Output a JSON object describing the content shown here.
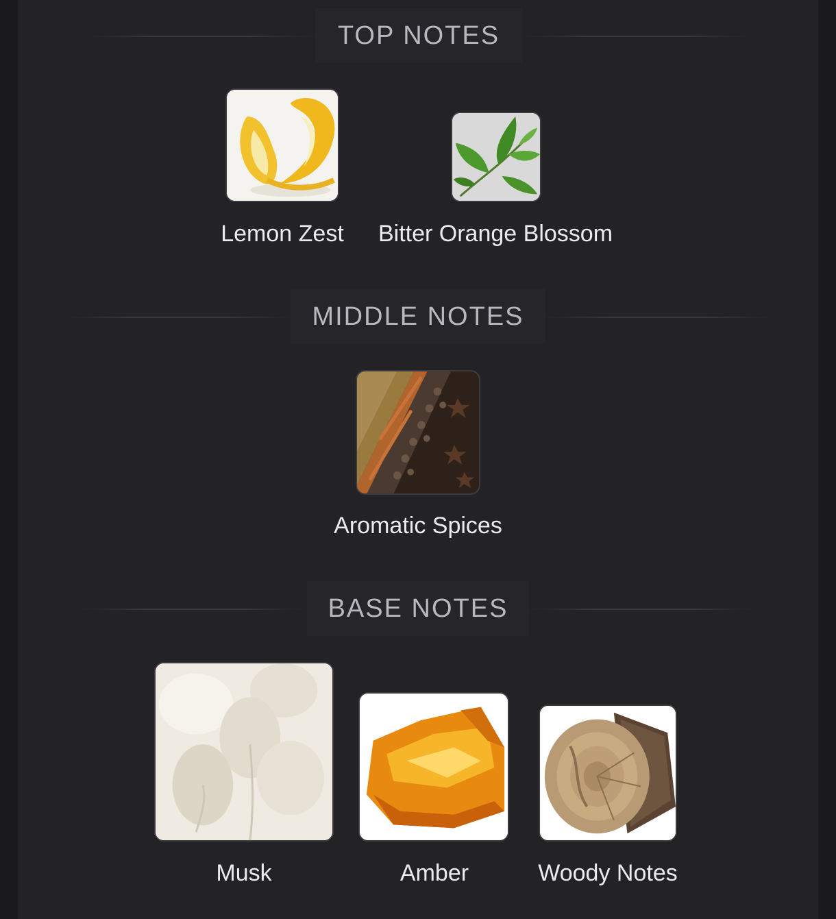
{
  "sections": {
    "top": {
      "title": "TOP NOTES",
      "notes": [
        {
          "label": "Lemon Zest",
          "icon": "lemon-zest-icon"
        },
        {
          "label": "Bitter Orange Blossom",
          "icon": "tea-leaf-sprig-icon"
        }
      ]
    },
    "middle": {
      "title": "MIDDLE NOTES",
      "notes": [
        {
          "label": "Aromatic Spices",
          "icon": "spices-icon"
        }
      ]
    },
    "base": {
      "title": "BASE NOTES",
      "notes": [
        {
          "label": "Musk",
          "icon": "fluffy-grass-icon"
        },
        {
          "label": "Amber",
          "icon": "amber-stone-icon"
        },
        {
          "label": "Woody Notes",
          "icon": "wood-log-icon"
        }
      ]
    }
  },
  "colors": {
    "background": "#1a1a1c",
    "panel": "#232326",
    "header_text": "#b8b8be",
    "label_text": "#ececee"
  }
}
